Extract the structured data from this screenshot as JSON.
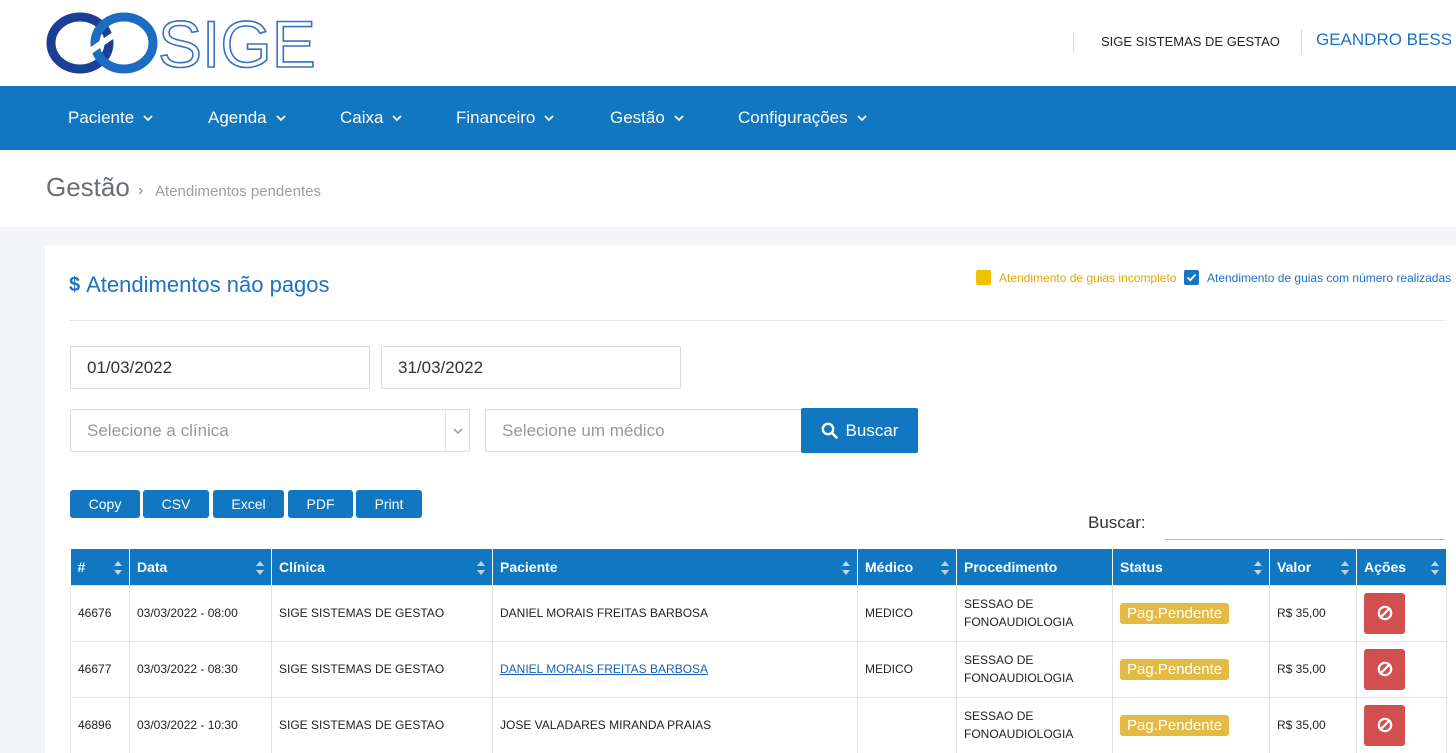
{
  "header": {
    "logo_text": "SIGE",
    "company": "SIGE SISTEMAS DE GESTAO",
    "user": "GEANDRO BESS"
  },
  "nav": [
    "Paciente",
    "Agenda",
    "Caixa",
    "Financeiro",
    "Gestão",
    "Configurações"
  ],
  "breadcrumb": {
    "title": "Gestão",
    "sub": "Atendimentos pendentes"
  },
  "card": {
    "title": "Atendimentos não pagos",
    "legend_incomplete": "Atendimento de guias incompleto",
    "legend_done": "Atendimento de guias com número realizadas"
  },
  "filters": {
    "date_from": "01/03/2022",
    "date_to": "31/03/2022",
    "clinic_placeholder": "Selecione a clínica",
    "doctor_placeholder": "Selecione um médico",
    "search_button": "Buscar"
  },
  "export": [
    "Copy",
    "CSV",
    "Excel",
    "PDF",
    "Print"
  ],
  "table_search_label": "Buscar:",
  "table": {
    "headers": [
      "#",
      "Data",
      "Clínica",
      "Paciente",
      "Médico",
      "Procedimento",
      "Status",
      "Valor",
      "Ações"
    ],
    "rows": [
      {
        "id": "46676",
        "date": "03/03/2022 - 08:00",
        "clinic": "SIGE SISTEMAS DE GESTAO",
        "patient": "DANIEL MORAIS FREITAS BARBOSA",
        "doctor": "MEDICO",
        "proc1": "SESSAO DE",
        "proc2": "FONOAUDIOLOGIA",
        "status": "Pag.Pendente",
        "value": "R$ 35,00"
      },
      {
        "id": "46677",
        "date": "03/03/2022 - 08:30",
        "clinic": "SIGE SISTEMAS DE GESTAO",
        "patient": "DANIEL MORAIS FREITAS BARBOSA",
        "doctor": "MEDICO",
        "proc1": "SESSAO DE",
        "proc2": "FONOAUDIOLOGIA",
        "status": "Pag.Pendente",
        "value": "R$ 35,00"
      },
      {
        "id": "46896",
        "date": "03/03/2022 - 10:30",
        "clinic": "SIGE SISTEMAS DE GESTAO",
        "patient": "JOSE VALADARES MIRANDA PRAIAS",
        "doctor": "",
        "proc1": "SESSAO DE",
        "proc2": "FONOAUDIOLOGIA",
        "status": "Pag.Pendente",
        "value": "R$ 35,00"
      }
    ]
  },
  "colors": {
    "primary": "#1177c1",
    "warning": "#e2ba44",
    "danger": "#d24f50",
    "legend_yellow": "#f2c200"
  }
}
